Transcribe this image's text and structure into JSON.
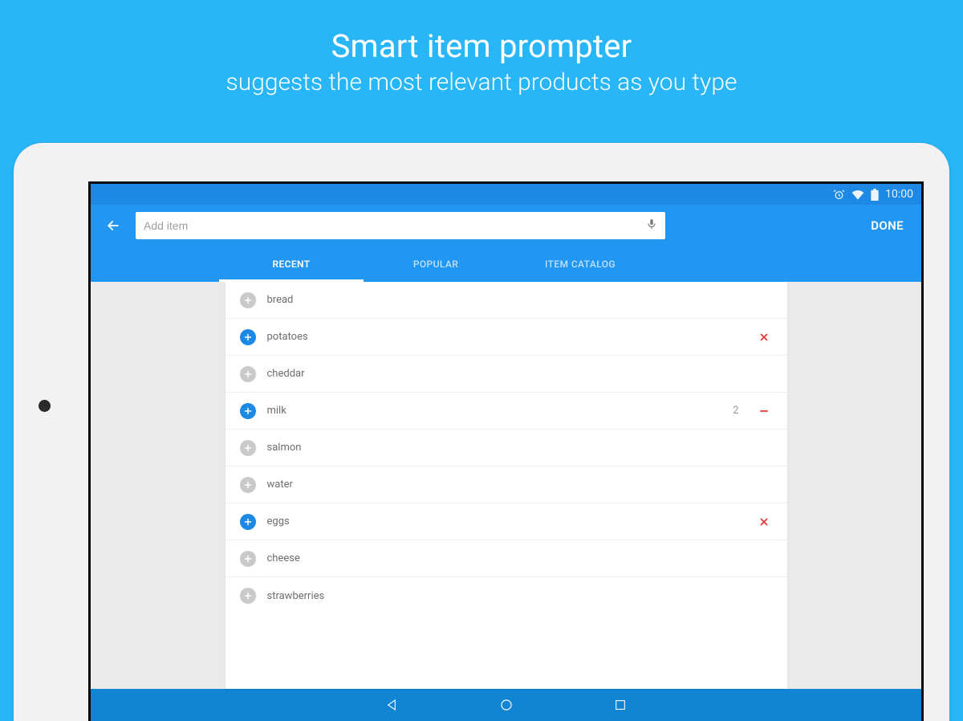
{
  "promo": {
    "title": "Smart item prompter",
    "subtitle": "suggests the most relevant products as you type"
  },
  "statusbar": {
    "time": "10:00"
  },
  "appbar": {
    "search_placeholder": "Add item",
    "done_label": "DONE"
  },
  "tabs": [
    {
      "label": "RECENT",
      "active": true
    },
    {
      "label": "POPULAR",
      "active": false
    },
    {
      "label": "ITEM CATALOG",
      "active": false
    }
  ],
  "items": [
    {
      "name": "bread",
      "added": false,
      "qty": null,
      "action": null
    },
    {
      "name": "potatoes",
      "added": true,
      "qty": null,
      "action": "remove"
    },
    {
      "name": "cheddar",
      "added": false,
      "qty": null,
      "action": null
    },
    {
      "name": "milk",
      "added": true,
      "qty": "2",
      "action": "decrement"
    },
    {
      "name": "salmon",
      "added": false,
      "qty": null,
      "action": null
    },
    {
      "name": "water",
      "added": false,
      "qty": null,
      "action": null
    },
    {
      "name": "eggs",
      "added": true,
      "qty": null,
      "action": "remove"
    },
    {
      "name": "cheese",
      "added": false,
      "qty": null,
      "action": null
    },
    {
      "name": "strawberries",
      "added": false,
      "qty": null,
      "action": null
    }
  ]
}
